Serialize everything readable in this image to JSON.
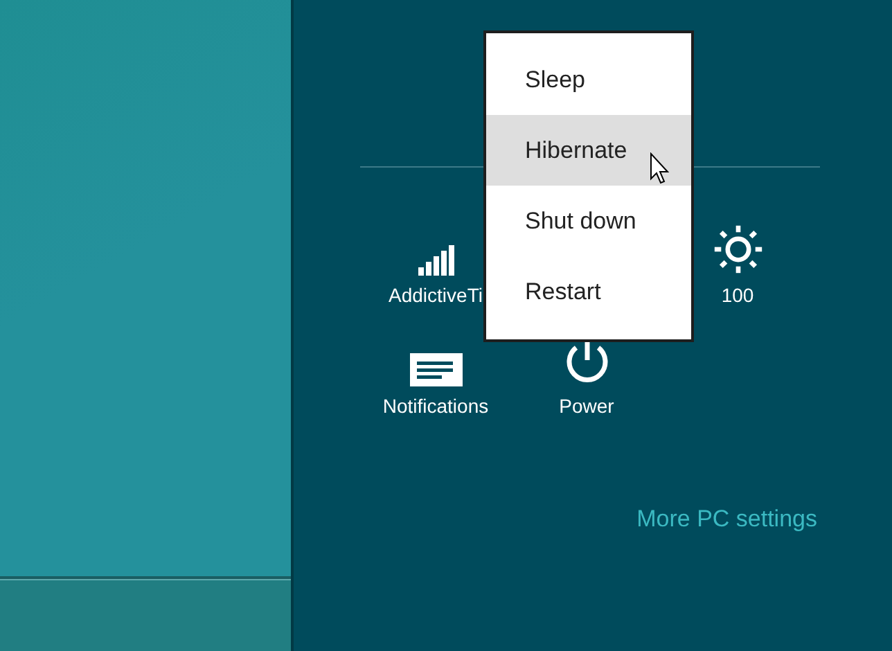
{
  "settings_panel": {
    "tile_rows": [
      [
        {
          "kind": "network",
          "label": "AddictiveTi"
        },
        {
          "kind": "brightness",
          "label": "100"
        }
      ],
      [
        {
          "kind": "notifications",
          "label": "Notifications"
        },
        {
          "kind": "power",
          "label": "Power"
        }
      ]
    ],
    "link": "More PC settings"
  },
  "power_menu": {
    "items": [
      {
        "label": "Sleep",
        "selected": false
      },
      {
        "label": "Hibernate",
        "selected": true
      },
      {
        "label": "Shut down",
        "selected": false
      },
      {
        "label": "Restart",
        "selected": false
      }
    ]
  }
}
